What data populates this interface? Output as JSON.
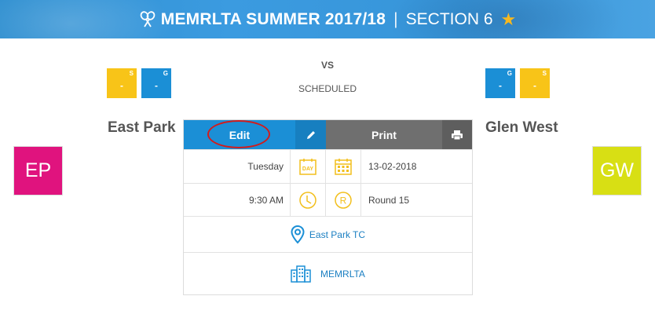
{
  "header": {
    "title": "MEMRLTA SUMMER 2017/18",
    "separator": "|",
    "section": "SECTION 6",
    "icons": [
      "tennis-rackets-icon",
      "star-icon"
    ],
    "accent": "#3b9be0"
  },
  "match": {
    "vs": "VS",
    "status": "SCHEDULED"
  },
  "home": {
    "name": "East Park",
    "abbr": "EP",
    "color": "#e0137e",
    "scores": [
      {
        "label": "S",
        "value": "-",
        "color": "#f8c418"
      },
      {
        "label": "G",
        "value": "-",
        "color": "#1b8fd6"
      }
    ]
  },
  "away": {
    "name": "Glen West",
    "abbr": "GW",
    "color": "#d8df14",
    "scores": [
      {
        "label": "G",
        "value": "-",
        "color": "#1b8fd6"
      },
      {
        "label": "S",
        "value": "-",
        "color": "#f8c418"
      }
    ]
  },
  "card": {
    "edit_label": "Edit",
    "print_label": "Print",
    "day": "Tuesday",
    "day_icon_text": "DAY",
    "date": "13-02-2018",
    "time": "9:30 AM",
    "round_icon_text": "R",
    "round": "Round 15",
    "venue": "East Park TC",
    "organisation": "MEMRLTA"
  }
}
